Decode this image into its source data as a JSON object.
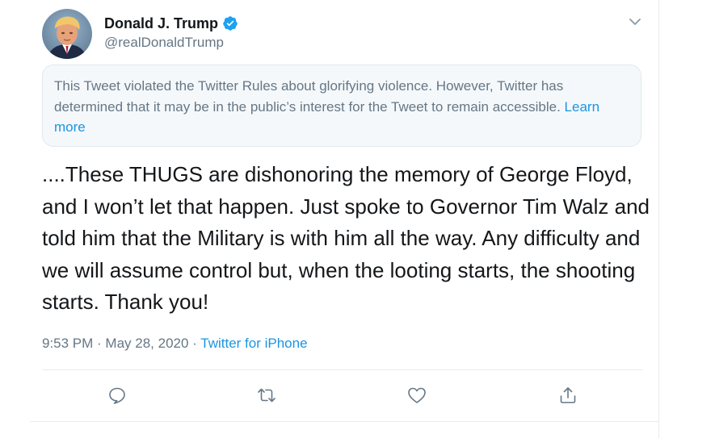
{
  "tweet": {
    "author": {
      "display_name": "Donald J. Trump",
      "handle": "@realDonaldTrump",
      "verified": true
    },
    "notice": {
      "text": "This Tweet violated the Twitter Rules about glorifying violence. However, Twitter has determined that it may be in the public’s interest for the Tweet to remain accessible.",
      "link_label": "Learn more"
    },
    "text": "....These THUGS are dishonoring the memory of George Floyd, and I won’t let that happen. Just spoke to Governor Tim Walz and told him that the Military is with him all the way. Any difficulty and we will assume control but, when the looting starts, the shooting starts. Thank you!",
    "timestamp": "9:53 PM · May 28, 2020",
    "separator": " · ",
    "source": "Twitter for iPhone"
  },
  "icons": {
    "verified": "verified-badge-icon",
    "menu": "chevron-down-icon",
    "reply": "speech-bubble-icon",
    "retweet": "retweet-arrows-icon",
    "like": "heart-outline-icon",
    "share": "share-upload-icon"
  },
  "colors": {
    "text_primary": "#14171a",
    "text_secondary": "#657786",
    "link": "#1b95e0",
    "verified": "#1da1f2",
    "notice_background": "#f5f8fa",
    "border": "#e6ecf0"
  }
}
